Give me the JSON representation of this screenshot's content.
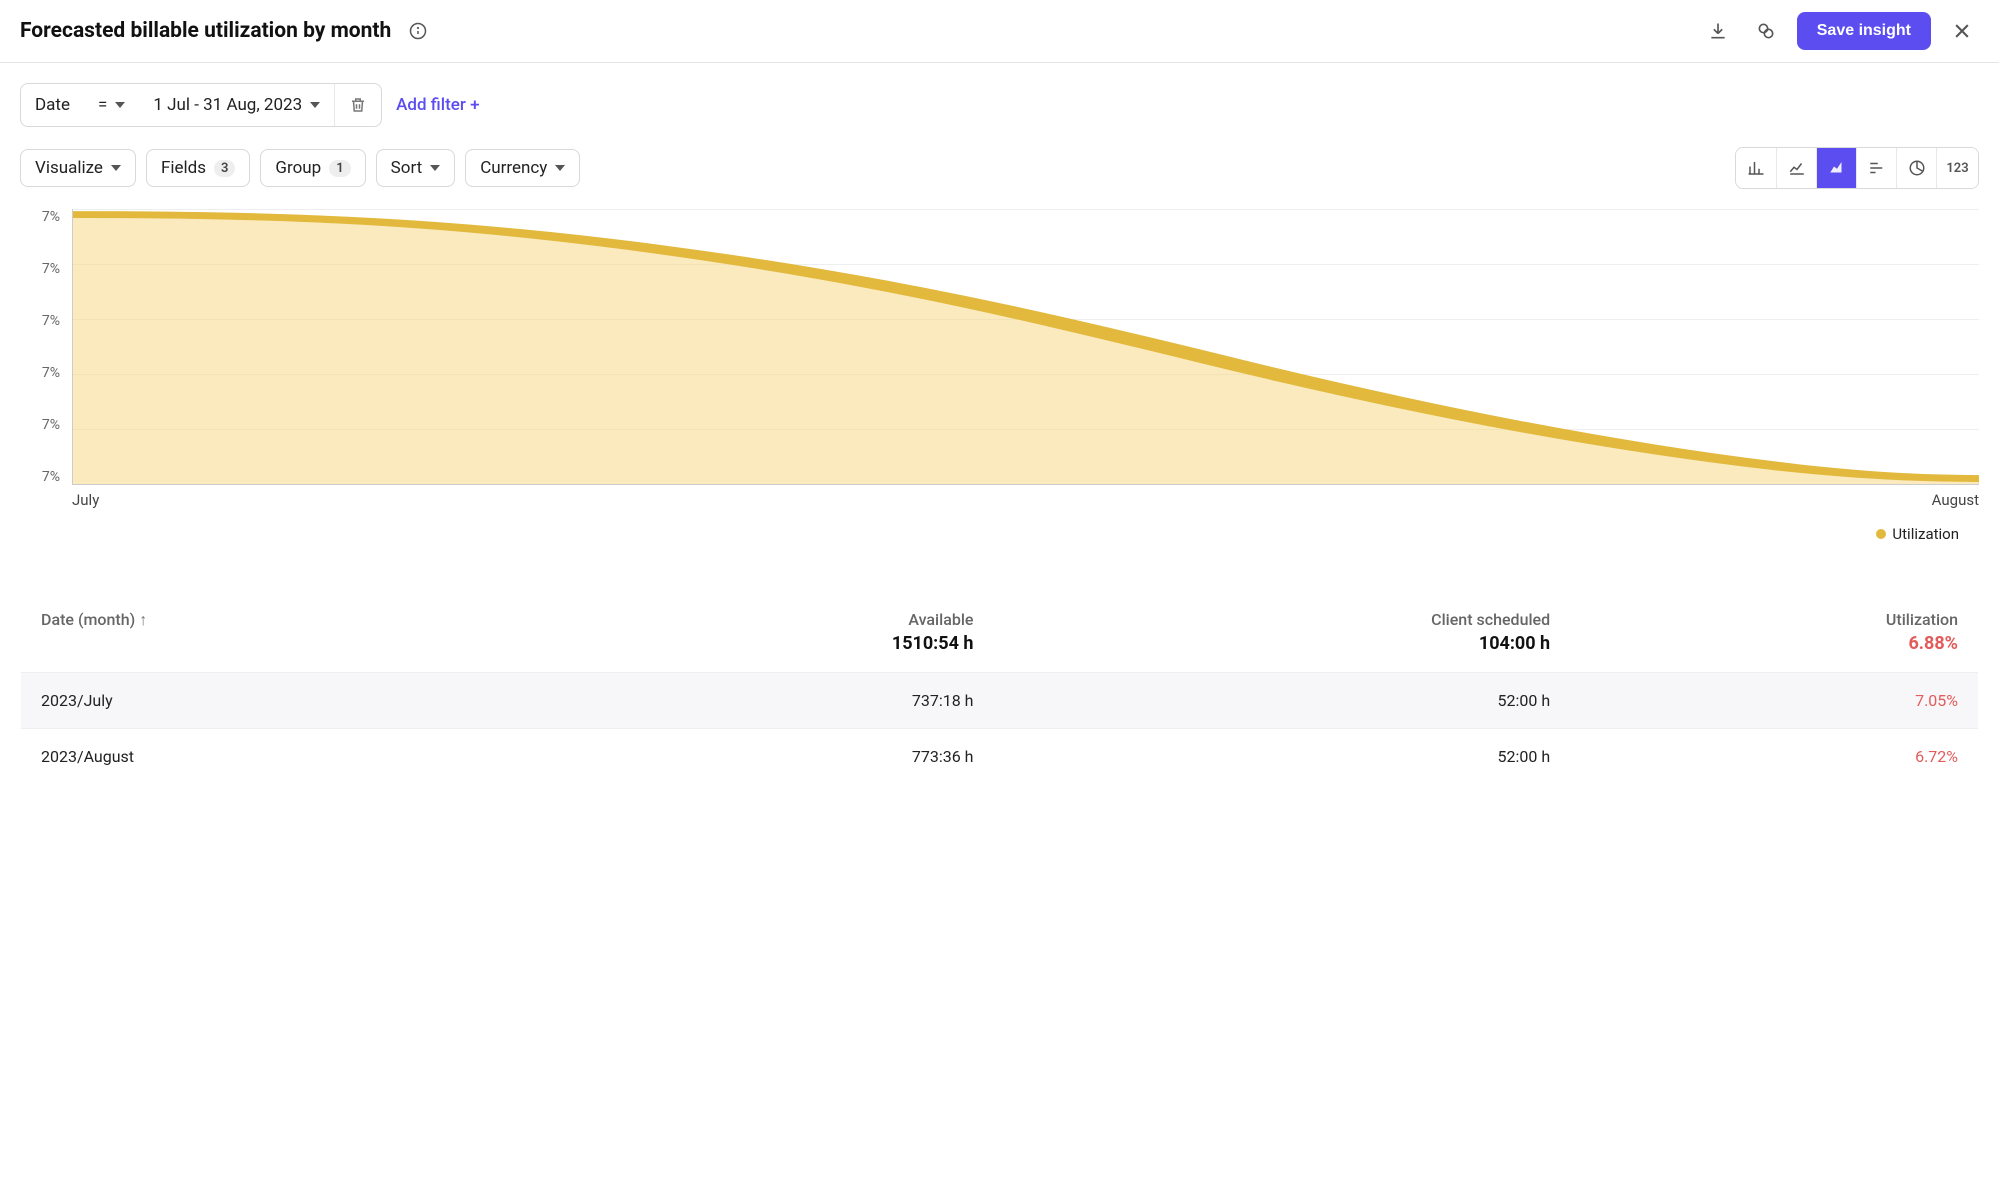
{
  "header": {
    "title": "Forecasted billable utilization by month",
    "save_label": "Save insight"
  },
  "filter": {
    "field": "Date",
    "operator": "=",
    "value": "1 Jul - 31 Aug, 2023",
    "add_label": "Add filter +"
  },
  "options": {
    "visualize": "Visualize",
    "fields": "Fields",
    "fields_count": "3",
    "group": "Group",
    "group_count": "1",
    "sort": "Sort",
    "currency": "Currency"
  },
  "view_num": "123",
  "chart_data": {
    "type": "area",
    "x": [
      "July",
      "August"
    ],
    "series": [
      {
        "name": "Utilization",
        "values": [
          7.05,
          6.72
        ]
      }
    ],
    "ylabel": "",
    "xlabel": "",
    "y_ticks": [
      "7%",
      "7%",
      "7%",
      "7%",
      "7%",
      "7%"
    ],
    "ylim": [
      6.7,
      7.1
    ],
    "legend": "Utilization",
    "color": "#e2b93c"
  },
  "table": {
    "col_date": "Date (month)",
    "col_available": "Available",
    "total_available": "1510:54 h",
    "col_client": "Client scheduled",
    "total_client": "104:00 h",
    "col_util": "Utilization",
    "total_util": "6.88%",
    "rows": [
      {
        "date": "2023/July",
        "available": "737:18 h",
        "client": "52:00 h",
        "util": "7.05%"
      },
      {
        "date": "2023/August",
        "available": "773:36 h",
        "client": "52:00 h",
        "util": "6.72%"
      }
    ]
  }
}
